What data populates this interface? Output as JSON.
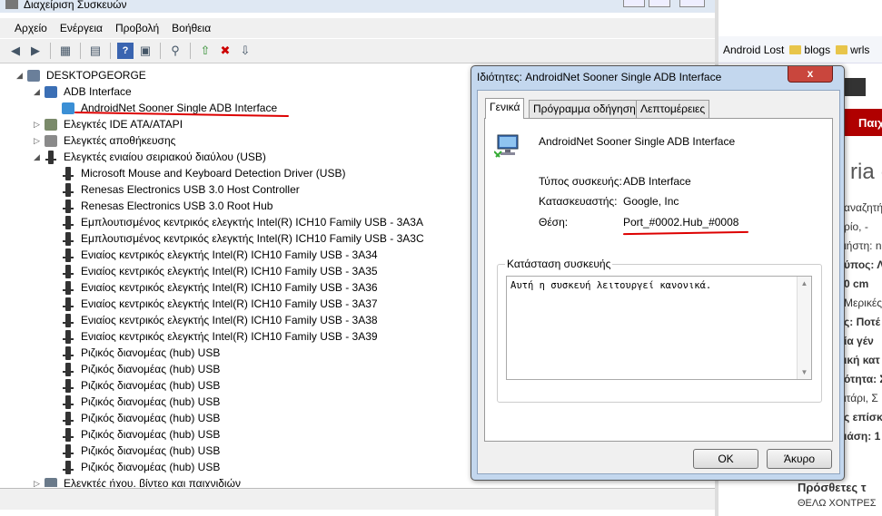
{
  "device_manager": {
    "title": "Διαχείριση Συσκευών",
    "menu": [
      "Αρχείο",
      "Ενέργεια",
      "Προβολή",
      "Βοήθεια"
    ],
    "toolbar_icons": [
      "back-arrow-icon",
      "forward-arrow-icon",
      "show-hide-tree-icon",
      "properties-icon",
      "help-icon",
      "scan-hardware-icon",
      "update-driver-icon",
      "uninstall-icon",
      "disable-device-icon"
    ],
    "tree": [
      {
        "label": "DESKTOPGEORGE",
        "level": 0,
        "icon": "computer-icon",
        "expander": "expanded"
      },
      {
        "label": "ADB Interface",
        "level": 1,
        "icon": "adb-icon",
        "expander": "expanded"
      },
      {
        "label": "AndroidNet Sooner Single ADB Interface",
        "level": 2,
        "icon": "adb-device-icon",
        "expander": "none"
      },
      {
        "label": "Ελεγκτές IDE ATA/ATAPI",
        "level": 1,
        "icon": "ide-controller-icon",
        "expander": "collapsed"
      },
      {
        "label": "Ελεγκτές αποθήκευσης",
        "level": 1,
        "icon": "storage-controller-icon",
        "expander": "collapsed"
      },
      {
        "label": "Ελεγκτές ενιαίου σειριακού διαύλου (USB)",
        "level": 1,
        "icon": "usb-icon",
        "expander": "expanded"
      },
      {
        "label": "Microsoft Mouse and Keyboard Detection Driver (USB)",
        "level": 2,
        "icon": "usb-icon",
        "expander": "none"
      },
      {
        "label": "Renesas Electronics USB 3.0 Host Controller",
        "level": 2,
        "icon": "usb-icon",
        "expander": "none"
      },
      {
        "label": "Renesas Electronics USB 3.0 Root Hub",
        "level": 2,
        "icon": "usb-icon",
        "expander": "none"
      },
      {
        "label": "Εμπλουτισμένος κεντρικός ελεγκτής Intel(R) ICH10 Family USB - 3A3A",
        "level": 2,
        "icon": "usb-icon",
        "expander": "none"
      },
      {
        "label": "Εμπλουτισμένος κεντρικός ελεγκτής Intel(R) ICH10 Family USB - 3A3C",
        "level": 2,
        "icon": "usb-icon",
        "expander": "none"
      },
      {
        "label": "Ενιαίος κεντρικός ελεγκτής Intel(R) ICH10 Family USB - 3A34",
        "level": 2,
        "icon": "usb-icon",
        "expander": "none"
      },
      {
        "label": "Ενιαίος κεντρικός ελεγκτής Intel(R) ICH10 Family USB - 3A35",
        "level": 2,
        "icon": "usb-icon",
        "expander": "none"
      },
      {
        "label": "Ενιαίος κεντρικός ελεγκτής Intel(R) ICH10 Family USB - 3A36",
        "level": 2,
        "icon": "usb-icon",
        "expander": "none"
      },
      {
        "label": "Ενιαίος κεντρικός ελεγκτής Intel(R) ICH10 Family USB - 3A37",
        "level": 2,
        "icon": "usb-icon",
        "expander": "none"
      },
      {
        "label": "Ενιαίος κεντρικός ελεγκτής Intel(R) ICH10 Family USB - 3A38",
        "level": 2,
        "icon": "usb-icon",
        "expander": "none"
      },
      {
        "label": "Ενιαίος κεντρικός ελεγκτής Intel(R) ICH10 Family USB - 3A39",
        "level": 2,
        "icon": "usb-icon",
        "expander": "none"
      },
      {
        "label": "Ριζικός διανομέας (hub) USB",
        "level": 2,
        "icon": "usb-icon",
        "expander": "none"
      },
      {
        "label": "Ριζικός διανομέας (hub) USB",
        "level": 2,
        "icon": "usb-icon",
        "expander": "none"
      },
      {
        "label": "Ριζικός διανομέας (hub) USB",
        "level": 2,
        "icon": "usb-icon",
        "expander": "none"
      },
      {
        "label": "Ριζικός διανομέας (hub) USB",
        "level": 2,
        "icon": "usb-icon",
        "expander": "none"
      },
      {
        "label": "Ριζικός διανομέας (hub) USB",
        "level": 2,
        "icon": "usb-icon",
        "expander": "none"
      },
      {
        "label": "Ριζικός διανομέας (hub) USB",
        "level": 2,
        "icon": "usb-icon",
        "expander": "none"
      },
      {
        "label": "Ριζικός διανομέας (hub) USB",
        "level": 2,
        "icon": "usb-icon",
        "expander": "none"
      },
      {
        "label": "Ριζικός διανομέας (hub) USB",
        "level": 2,
        "icon": "usb-icon",
        "expander": "none"
      },
      {
        "label": "Ελεγκτές ήχου, βίντεο και παιχνιδιών",
        "level": 1,
        "icon": "sound-icon",
        "expander": "collapsed"
      }
    ]
  },
  "properties_dialog": {
    "title": "Ιδιότητες: AndroidNet Sooner Single ADB Interface",
    "close_label": "x",
    "tabs": [
      "Γενικά",
      "Πρόγραμμα οδήγησης",
      "Λεπτομέρειες"
    ],
    "active_tab": "Γενικά",
    "device_name": "AndroidNet Sooner Single ADB Interface",
    "fields": [
      {
        "label": "Τύπος συσκευής:",
        "value": "ADB Interface"
      },
      {
        "label": "Κατασκευαστής:",
        "value": "Google, Inc"
      },
      {
        "label": "Θέση:",
        "value": "Port_#0002.Hub_#0008"
      }
    ],
    "status_group_title": "Κατάσταση συσκευής",
    "status_text": "Αυτή η συσκευή λειτουργεί κανονικά.",
    "ok_label": "OK",
    "cancel_label": "Άκυρο"
  },
  "browser": {
    "bookmarks": [
      "Android Lost",
      "blogs",
      "wrls"
    ],
    "nav_fragment": "Παιχ",
    "heading_fragment": "ria (",
    "content_fragments": [
      "αναζητή",
      "ρίο, -",
      "ιήστη: n",
      "ύπος: Λι",
      "0 cm",
      "Μερικές",
      "ς: Ποτέ",
      "ία γέν",
      "ική κατ",
      "ότητα: Σ",
      "ιτάρι, Σ",
      "ς επίσκ",
      "ιάση: 1"
    ],
    "footer_heading": "Πρόσθετες τ",
    "footer_text": "ΘΕΛΩ ΧΟΝΤΡΕΣ"
  },
  "colors": {
    "annotation_red": "#dd0000",
    "dialog_frame": "#c3d7ee",
    "close_red": "#c9463d"
  }
}
